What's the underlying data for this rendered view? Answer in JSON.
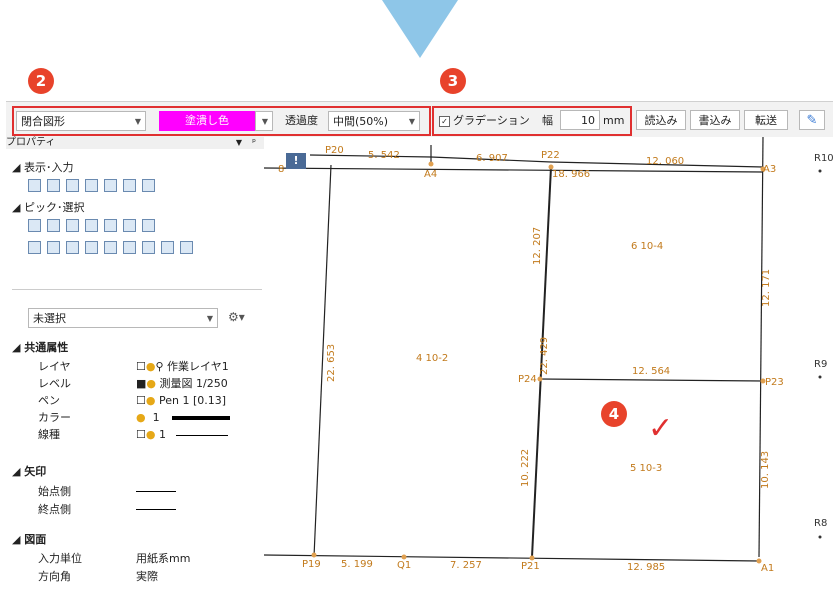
{
  "badges": {
    "b2": "2",
    "b3": "3",
    "b4": "4"
  },
  "toolbar": {
    "shape_type": "閉合図形",
    "fill_color_label": "塗潰し色",
    "transparency_label": "透過度",
    "transparency_value": "中間(50%)",
    "gradation_label": "グラデーション",
    "width_label": "幅",
    "width_value": "10",
    "width_unit": "mm",
    "read_label": "読込み",
    "write_label": "書込み",
    "transfer_label": "転送"
  },
  "panel": {
    "title": "プロパティ",
    "display_section": "表示･入力",
    "pick_section": "ピック･選択",
    "selection": "未選択",
    "common_section": "共通属性",
    "arrow_section": "矢印",
    "drawing_section": "図面",
    "props": [
      {
        "key": "レイヤ",
        "value": "作業レイヤ1"
      },
      {
        "key": "レベル",
        "value": "測量図 1/250"
      },
      {
        "key": "ペン",
        "value": "Pen 1 [0.13]"
      },
      {
        "key": "カラー",
        "value": "1"
      },
      {
        "key": "線種",
        "value": "1"
      }
    ],
    "arrow_props": [
      {
        "key": "始点側"
      },
      {
        "key": "終点側"
      }
    ],
    "drawing_props": [
      {
        "key": "入力単位",
        "value": "用紙系mm"
      },
      {
        "key": "方向角",
        "value": "実際"
      }
    ]
  },
  "canvas": {
    "points": {
      "p20": "P20",
      "a4": "A4",
      "p22": "P22",
      "a3": "A3",
      "r10": "R10",
      "p24": "P24",
      "p23": "P23",
      "r9": "R9",
      "r8": "R8",
      "p19": "P19",
      "q1": "Q1",
      "p21": "P21",
      "a1": "A1",
      "p8": "8"
    },
    "dims": {
      "d1": "5. 542",
      "d2": "6. 907",
      "d3": "12. 060",
      "d4": "18. 966",
      "d5": "12. 207",
      "d6": "12. 171",
      "d7": "22. 653",
      "d8": "22. 429",
      "d9": "12. 564",
      "d10": "10. 222",
      "d11": "10. 143",
      "d12": "5. 199",
      "d13": "7. 257",
      "d14": "12. 985"
    },
    "parcels": {
      "p1": "4 10-2",
      "p2": "6 10-4",
      "p3": "5 10-3"
    }
  },
  "colors": {
    "accent_red": "#e03030",
    "fill_magenta": "#ff00ff",
    "arrow_blue": "#8ec6e8"
  }
}
